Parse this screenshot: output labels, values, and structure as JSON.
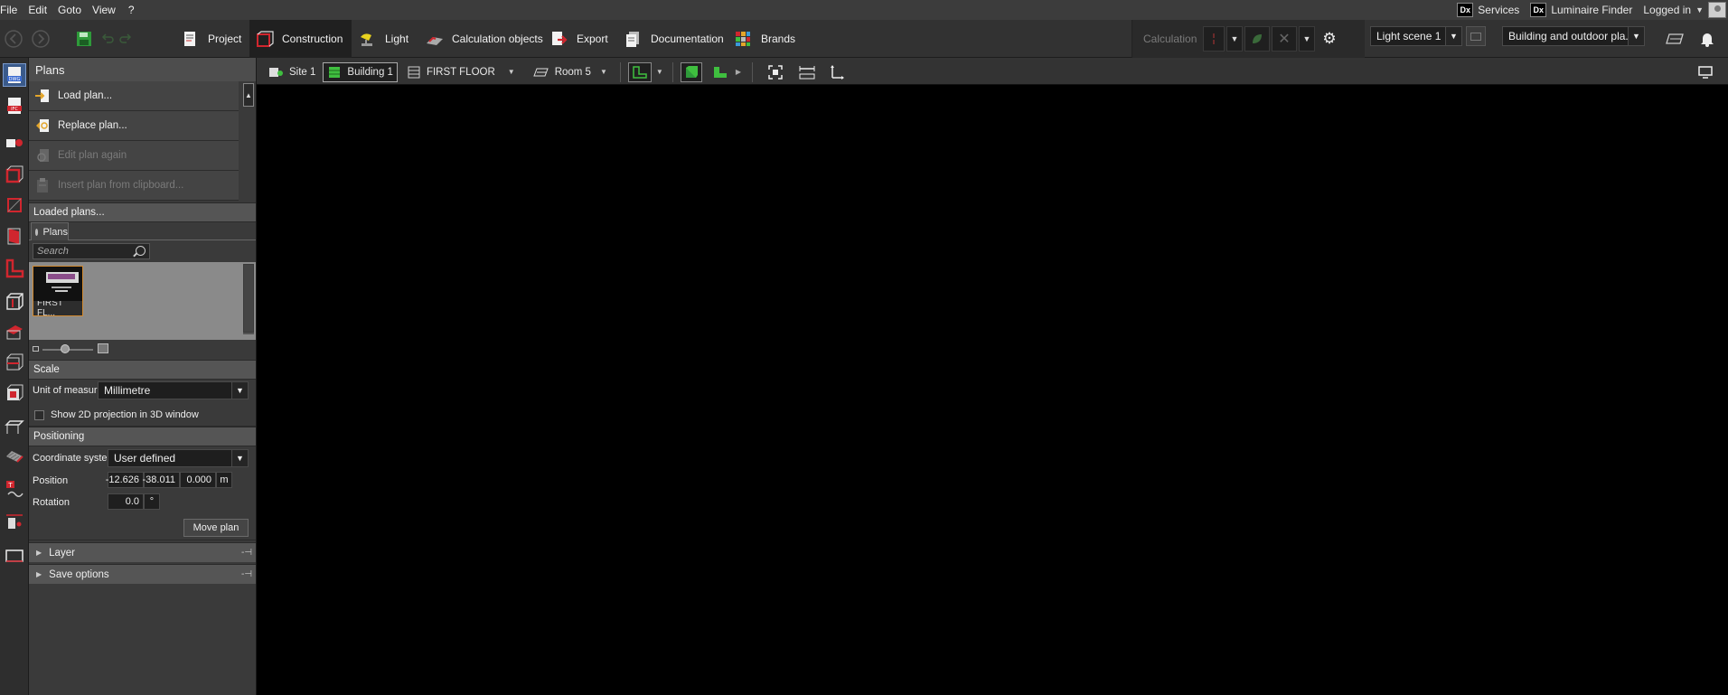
{
  "menubar": {
    "items": [
      "File",
      "Edit",
      "Goto",
      "View",
      "?"
    ],
    "services": "Services",
    "luminaire_finder": "Luminaire Finder",
    "logged_in": "Logged in",
    "dx_label": "Dx"
  },
  "toolbar": {
    "tabs": [
      "Project",
      "Construction",
      "Light",
      "Calculation objects",
      "Export",
      "Documentation",
      "Brands"
    ],
    "active_tab": "Construction",
    "calculation_label": "Calculation",
    "light_scene": "Light scene 1",
    "view_mode": "Building and outdoor pla..."
  },
  "viewbar": {
    "site": "Site 1",
    "building": "Building 1",
    "floor": "FIRST FLOOR",
    "room": "Room 5"
  },
  "panel": {
    "title": "Plans",
    "actions": {
      "load": "Load plan...",
      "replace": "Replace plan...",
      "edit_again": "Edit plan again",
      "insert_clipboard": "Insert plan from clipboard..."
    },
    "loaded_plans": "Loaded plans...",
    "plans_tab": "Plans",
    "search_placeholder": "Search",
    "thumbnail_caption": "FIRST FL...",
    "scale": {
      "header": "Scale",
      "unit_label": "Unit of measure",
      "unit_value": "Millimetre",
      "show_2d": "Show 2D projection in 3D window"
    },
    "positioning": {
      "header": "Positioning",
      "coord_label": "Coordinate system",
      "coord_value": "User defined",
      "position_label": "Position",
      "pos_x": "-12.626",
      "pos_y": "-38.011",
      "pos_z": "0.000",
      "pos_unit": "m",
      "rotation_label": "Rotation",
      "rotation_value": "0.0",
      "rotation_unit": "°",
      "move_button": "Move plan"
    },
    "layer": "Layer",
    "save_options": "Save options"
  },
  "colors": {
    "accent_red": "#d0262e",
    "accent_green": "#3fbf3f",
    "selection_orange": "#d28a30"
  }
}
